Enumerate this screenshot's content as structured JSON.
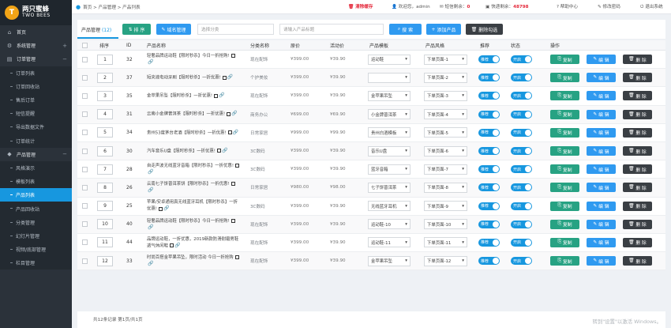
{
  "sidebar": {
    "logo_mark": "T",
    "brand_cn": "两只蜜蜂",
    "brand_en": "TWO BEES",
    "items": [
      {
        "label": "首页",
        "icon": "home-icon",
        "glyph": "⌂",
        "type": "top",
        "arrow": ""
      },
      {
        "label": "系统管理",
        "icon": "settings-icon",
        "glyph": "⚙",
        "type": "top",
        "arrow": "+"
      },
      {
        "label": "订单管理",
        "icon": "order-icon",
        "glyph": "▤",
        "type": "top",
        "arrow": "−"
      },
      {
        "label": "订单列表",
        "type": "sub"
      },
      {
        "label": "订单回收站",
        "type": "sub"
      },
      {
        "label": "售后订单",
        "type": "sub"
      },
      {
        "label": "短信提醒",
        "type": "sub"
      },
      {
        "label": "导出数据文件",
        "type": "sub"
      },
      {
        "label": "订单统计",
        "type": "sub"
      },
      {
        "label": "产品管理",
        "icon": "product-icon",
        "glyph": "◆",
        "type": "top",
        "arrow": "−"
      },
      {
        "label": "风格演示",
        "type": "sub"
      },
      {
        "label": "模板列表",
        "type": "sub"
      },
      {
        "label": "产品列表",
        "type": "sub",
        "active": true
      },
      {
        "label": "产品回收站",
        "type": "sub"
      },
      {
        "label": "分类管理",
        "type": "sub"
      },
      {
        "label": "幻灯片管理",
        "type": "sub"
      },
      {
        "label": "视频/底部管理",
        "type": "sub"
      },
      {
        "label": "栏目管理",
        "type": "sub"
      }
    ]
  },
  "topbar": {
    "breadcrumb": "首页 > 产品管理 > 产品列表",
    "clear_cache": "清除缓存",
    "welcome": "欢迎您，admin",
    "sms_left_label": "短信剩余：",
    "sms_left_value": "0",
    "express_left_label": "快递剩余：",
    "express_left_value": "48798",
    "help": "帮助中心",
    "change_pwd": "修改密码",
    "logout": "退出系统"
  },
  "toolbar": {
    "tab_label": "产品管理",
    "tab_count": "(12)",
    "sort_btn": "排 序",
    "domain_btn": "域名管理",
    "category_placeholder": "选择分类",
    "search_placeholder": "请输入产品标题",
    "search_btn": "搜 索",
    "add_btn": "添加产品",
    "batch_delete_btn": "删除勾选"
  },
  "table": {
    "headers": [
      "排序",
      "ID",
      "产品名称",
      "分类名称",
      "原价",
      "活动价",
      "产品模板",
      "产品风格",
      "推荐",
      "状态",
      "操作"
    ],
    "row_actions": {
      "copy": "复制",
      "edit": "编 辑",
      "delete": "删 除"
    },
    "toggle_text": "推荐",
    "status_text": "开启",
    "rows": [
      {
        "sort": "1",
        "id": "32",
        "name": "轻奢品牌运动鞋【限时秒杀】今日一折抢购!",
        "cat": "现在配饰",
        "price": "¥399.00",
        "sale": "¥39.90",
        "tpl": "运动鞋",
        "style": "下单页面-1"
      },
      {
        "sort": "2",
        "id": "37",
        "name": "短夹液电动牙刷【限时秒杀】一折优惠!",
        "cat": "个护美妆",
        "price": "¥399.00",
        "sale": "¥39.90",
        "tpl": "",
        "style": "下单页面-2"
      },
      {
        "sort": "3",
        "id": "35",
        "name": "金苹果吊坠【限时秒杀】一折优惠!",
        "cat": "现在配饰",
        "price": "¥399.00",
        "sale": "¥39.90",
        "tpl": "金苹果吊坠",
        "style": "下单页面-3"
      },
      {
        "sort": "4",
        "id": "31",
        "name": "云南小金牌普洱茶【限时秒杀】一折优惠!",
        "cat": "商务办公",
        "price": "¥699.00",
        "sale": "¥69.90",
        "tpl": "小金牌普洱茶",
        "style": "下单页面-4"
      },
      {
        "sort": "5",
        "id": "34",
        "name": "贵州53度茅台老酒【限时秒杀】一折优惠!",
        "cat": "日常家居",
        "price": "¥999.00",
        "sale": "¥99.90",
        "tpl": "贵州白酒模板",
        "style": "下单页面-5"
      },
      {
        "sort": "6",
        "id": "30",
        "name": "汽车音乐U盘【限时秒杀】一折优惠!",
        "cat": "3C数码",
        "price": "¥399.00",
        "sale": "¥39.90",
        "tpl": "音乐U盘",
        "style": "下单页面-6"
      },
      {
        "sort": "7",
        "id": "28",
        "name": "自走声波无线蓝牙音箱【限时秒杀】一折优惠!",
        "cat": "3C数码",
        "price": "¥399.00",
        "sale": "¥39.90",
        "tpl": "蓝牙音箱",
        "style": "下单页面-7"
      },
      {
        "sort": "8",
        "id": "26",
        "name": "云南七子饼普洱茶饼【限时秒杀】一折优惠!",
        "cat": "日常家居",
        "price": "¥980.00",
        "sale": "¥98.00",
        "tpl": "七子饼普洱茶",
        "style": "下单页面-8"
      },
      {
        "sort": "9",
        "id": "25",
        "name": "苹果/安卓通用真无线蓝牙耳机【限时秒杀】一折优惠!",
        "cat": "3C数码",
        "price": "¥399.00",
        "sale": "¥39.90",
        "tpl": "无线蓝牙耳机",
        "style": "下单页面-9"
      },
      {
        "sort": "10",
        "id": "40",
        "name": "轻奢品牌运动鞋【限时秒杀】今日一折抢购!",
        "cat": "现在配饰",
        "price": "¥399.00",
        "sale": "¥39.90",
        "tpl": "运动鞋-10",
        "style": "下单页面-10"
      },
      {
        "sort": "11",
        "id": "44",
        "name": "品牌运动鞋，一折优惠，2019新款防滑耐磨男鞋透气休闲鞋",
        "cat": "现在配饰",
        "price": "¥399.00",
        "sale": "¥39.90",
        "tpl": "运动鞋-11",
        "style": "下单页面-11"
      },
      {
        "sort": "12",
        "id": "33",
        "name": "时尚百搭金苹果吊坠，限时活动 今日一折抢购",
        "cat": "现在配饰",
        "price": "¥399.00",
        "sale": "¥39.90",
        "tpl": "金苹果吊坠",
        "style": "下单页面-12"
      }
    ]
  },
  "footer": {
    "summary": "共12条记录 第1页/共1页"
  },
  "watermark": "转到\"设置\"以激活 Windows。"
}
